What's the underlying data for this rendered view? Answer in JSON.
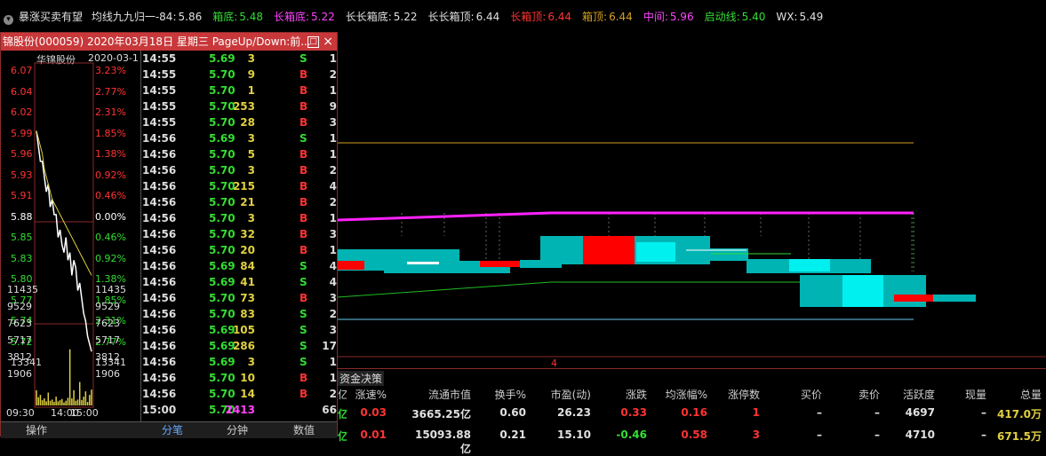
{
  "header": {
    "indicator_name": "暴涨买卖有望",
    "items": [
      {
        "label": "均线九九归一-84:",
        "value": "5.86",
        "color": "#e0e0e0"
      },
      {
        "label": "箱底:",
        "value": "5.48",
        "color": "#33dd33"
      },
      {
        "label": "长箱底:",
        "value": "5.22",
        "color": "#ff44ff"
      },
      {
        "label": "长长箱底:",
        "value": "5.22",
        "color": "#e0e0e0"
      },
      {
        "label": "长长箱顶:",
        "value": "6.44",
        "color": "#e0e0e0"
      },
      {
        "label": "长箱顶:",
        "value": "6.44",
        "color": "#ff3333"
      },
      {
        "label": "箱顶:",
        "value": "6.44",
        "color": "#d4a020"
      },
      {
        "label": "中间:",
        "value": "5.96",
        "color": "#ff44ff"
      },
      {
        "label": "启动线:",
        "value": "5.40",
        "color": "#33dd33"
      },
      {
        "label": "WX:",
        "value": "5.49",
        "color": "#e0e0e0"
      }
    ]
  },
  "popup": {
    "title": "锦股份(000059) 2020年03月18日 星期三 PageUp/Down:前...",
    "minimize_glyph": "□",
    "close_glyph": "×",
    "mini_chart": {
      "stock_label": "华锦股份",
      "date_label": "2020-03-1",
      "price_ticks": [
        {
          "left": "6.07",
          "right": "3.23%",
          "color": "#ff3333"
        },
        {
          "left": "6.04",
          "right": "2.77%",
          "color": "#ff3333"
        },
        {
          "left": "6.02",
          "right": "2.31%",
          "color": "#ff3333"
        },
        {
          "left": "5.99",
          "right": "1.85%",
          "color": "#ff3333"
        },
        {
          "left": "5.96",
          "right": "1.38%",
          "color": "#ff3333"
        },
        {
          "left": "5.93",
          "right": "0.92%",
          "color": "#ff3333"
        },
        {
          "left": "5.91",
          "right": "0.46%",
          "color": "#ff3333"
        },
        {
          "left": "5.88",
          "right": "0.00%",
          "color": "#ffffff"
        },
        {
          "left": "5.85",
          "right": "0.46%",
          "color": "#33dd33"
        },
        {
          "left": "5.83",
          "right": "0.92%",
          "color": "#33dd33"
        },
        {
          "left": "5.80",
          "right": "1.38%",
          "color": "#33dd33"
        },
        {
          "left": "5.77",
          "right": "1.85%",
          "color": "#33dd33"
        },
        {
          "left": "5.74",
          "right": "2.31%",
          "color": "#33dd33"
        },
        {
          "left": "5.72",
          "right": "2.77%",
          "color": "#33dd33"
        },
        {
          "left": "13341",
          "right": "13341",
          "color": "#dddddd"
        }
      ],
      "volume_ticks": [
        "11435",
        "9529",
        "7623",
        "5717",
        "3812",
        "1906"
      ],
      "time_labels": [
        "09:30",
        "14:00",
        "15:00"
      ],
      "tick_label_0": "14",
      "series": {
        "price": [
          5.99,
          5.97,
          5.95,
          5.95,
          5.93,
          5.91,
          5.92,
          5.89,
          5.9,
          5.88,
          5.88,
          5.85,
          5.86,
          5.84,
          5.83,
          5.85,
          5.82,
          5.83,
          5.8,
          5.82,
          5.81,
          5.78,
          5.79,
          5.77,
          5.75,
          5.74,
          5.72,
          5.71,
          5.7
        ],
        "average": [
          5.99,
          5.98,
          5.97,
          5.96,
          5.94,
          5.93,
          5.92,
          5.91,
          5.9,
          5.895,
          5.89,
          5.885,
          5.88,
          5.875,
          5.87,
          5.865,
          5.86,
          5.855,
          5.85,
          5.845,
          5.84,
          5.835,
          5.83,
          5.825,
          5.82,
          5.815,
          5.81,
          5.805,
          5.8
        ],
        "volume": [
          2600,
          1400,
          1800,
          900,
          1200,
          700,
          2200,
          800,
          1000,
          600,
          1500,
          700,
          900,
          1100,
          500,
          800,
          1300,
          9600,
          1200,
          2600,
          800,
          1000,
          4000,
          900,
          1500,
          2400,
          600,
          1800,
          2700
        ]
      }
    },
    "trades": [
      {
        "time": "14:55",
        "price": "5.69",
        "vol": "3",
        "side": "S",
        "n": "1"
      },
      {
        "time": "14:55",
        "price": "5.70",
        "vol": "9",
        "side": "B",
        "n": "2"
      },
      {
        "time": "14:55",
        "price": "5.70",
        "vol": "1",
        "side": "B",
        "n": "1"
      },
      {
        "time": "14:55",
        "price": "5.70",
        "vol": "253",
        "side": "B",
        "n": "9"
      },
      {
        "time": "14:55",
        "price": "5.70",
        "vol": "28",
        "side": "B",
        "n": "3"
      },
      {
        "time": "14:56",
        "price": "5.69",
        "vol": "3",
        "side": "S",
        "n": "1"
      },
      {
        "time": "14:56",
        "price": "5.70",
        "vol": "5",
        "side": "B",
        "n": "1"
      },
      {
        "time": "14:56",
        "price": "5.70",
        "vol": "3",
        "side": "B",
        "n": "2"
      },
      {
        "time": "14:56",
        "price": "5.70",
        "vol": "215",
        "side": "B",
        "n": "4"
      },
      {
        "time": "14:56",
        "price": "5.70",
        "vol": "21",
        "side": "B",
        "n": "2"
      },
      {
        "time": "14:56",
        "price": "5.70",
        "vol": "3",
        "side": "B",
        "n": "1"
      },
      {
        "time": "14:56",
        "price": "5.70",
        "vol": "32",
        "side": "B",
        "n": "3"
      },
      {
        "time": "14:56",
        "price": "5.70",
        "vol": "20",
        "side": "B",
        "n": "1"
      },
      {
        "time": "14:56",
        "price": "5.69",
        "vol": "84",
        "side": "S",
        "n": "4"
      },
      {
        "time": "14:56",
        "price": "5.69",
        "vol": "41",
        "side": "S",
        "n": "4"
      },
      {
        "time": "14:56",
        "price": "5.70",
        "vol": "73",
        "side": "B",
        "n": "3"
      },
      {
        "time": "14:56",
        "price": "5.70",
        "vol": "83",
        "side": "S",
        "n": "2"
      },
      {
        "time": "14:56",
        "price": "5.69",
        "vol": "105",
        "side": "S",
        "n": "3"
      },
      {
        "time": "14:56",
        "price": "5.69",
        "vol": "286",
        "side": "S",
        "n": "17"
      },
      {
        "time": "14:56",
        "price": "5.69",
        "vol": "3",
        "side": "S",
        "n": "1"
      },
      {
        "time": "14:56",
        "price": "5.70",
        "vol": "10",
        "side": "B",
        "n": "1"
      },
      {
        "time": "14:56",
        "price": "5.70",
        "vol": "14",
        "side": "B",
        "n": "2"
      },
      {
        "time": "15:00",
        "price": "5.70",
        "vol": "2413",
        "side": "",
        "n": "66"
      }
    ],
    "tabs": [
      "操作",
      "分笔",
      "分钟",
      "数值"
    ]
  },
  "main_chart": {
    "x_marker": "4",
    "lines": {
      "box_top": {
        "color": "#d4a020"
      },
      "middle": {
        "color": "#ff22ff"
      },
      "start_line": {
        "color": "#22bb22"
      },
      "box_bottom": {
        "color": "#66ccee"
      }
    }
  },
  "bottom": {
    "tab_label": "资金决策",
    "columns": [
      "亿",
      "涨速%",
      "流通市值",
      "换手%",
      "市盈(动)",
      "涨跌",
      "均涨幅%",
      "涨停数",
      "买价",
      "卖价",
      "活跃度",
      "现量",
      "总量"
    ],
    "rows": [
      [
        "亿",
        "0.03",
        "3665.25亿",
        "0.60",
        "26.23",
        "0.33",
        "0.16",
        "1",
        "–",
        "–",
        "4697",
        "–",
        "417.0万"
      ],
      [
        "亿",
        "0.01",
        "15093.88亿",
        "0.21",
        "15.10",
        "-0.46",
        "0.58",
        "3",
        "–",
        "–",
        "4710",
        "–",
        "671.5万"
      ]
    ]
  }
}
